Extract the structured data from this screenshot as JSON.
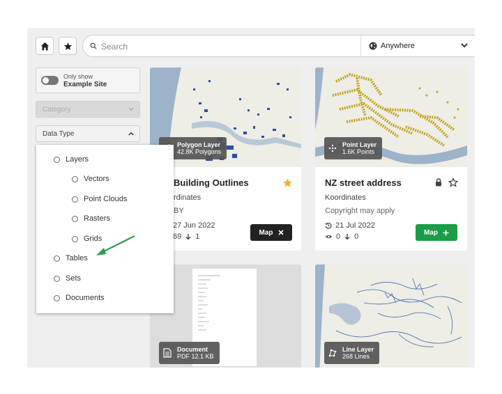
{
  "search": {
    "placeholder": "Search"
  },
  "location": {
    "label": "Anywhere"
  },
  "filters": {
    "toggle_line1": "Only show",
    "toggle_line2": "Example Site",
    "category_label": "Category",
    "data_type_label": "Data Type"
  },
  "data_type_options": {
    "layers": "Layers",
    "vectors": "Vectors",
    "point_clouds": "Point Clouds",
    "rasters": "Rasters",
    "grids": "Grids",
    "tables": "Tables",
    "sets": "Sets",
    "documents": "Documents"
  },
  "cards": [
    {
      "badge_type": "Polygon Layer",
      "badge_sub": "42.8K Polygons",
      "title": "Building Outlines",
      "publisher": "rdinates",
      "license": "BY",
      "date": "27 Jun 2022",
      "views": "69",
      "downloads": "1",
      "button": "Map",
      "button_icon": "close-icon",
      "starred": true
    },
    {
      "badge_type": "Point Layer",
      "badge_sub": "1.6K Points",
      "title": "NZ street address",
      "publisher": "Koordinates",
      "license": "Copyright may apply",
      "date": "21 Jul 2022",
      "views": "0",
      "downloads": "0",
      "button": "Map",
      "button_icon": "plus-icon",
      "starred": false
    },
    {
      "badge_type": "Document",
      "badge_sub": "PDF 12.1 KB"
    },
    {
      "badge_type": "Line Layer",
      "badge_sub": "268 Lines"
    }
  ],
  "colors": {
    "accent_green": "#1a9c48",
    "dark_button": "#222222",
    "star_gold": "#f3b229",
    "water": "#9db3c9",
    "arrow_green": "#2e9e48"
  }
}
